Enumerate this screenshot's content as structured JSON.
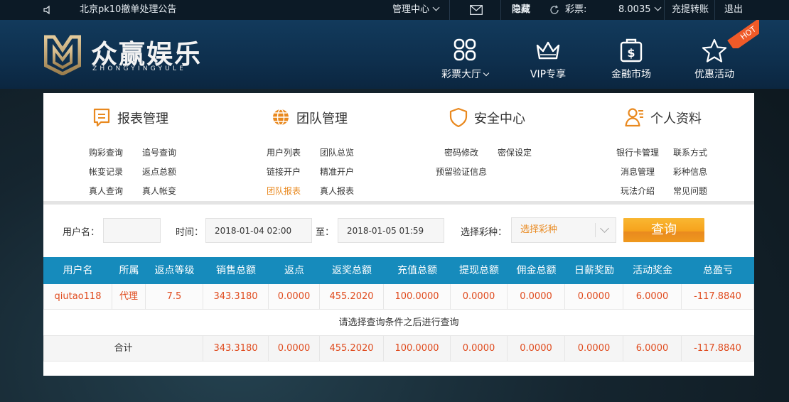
{
  "topbar": {
    "notice": "北京pk10撤单处理公告",
    "manage_center": "管理中心",
    "hide": "隐藏",
    "lottery_label": "彩票:",
    "balance": "8.0035",
    "deposit_withdraw": "充提转账",
    "logout": "退出"
  },
  "header": {
    "logo_cn": "众赢娱乐",
    "logo_en": "ZHONGYINGYULE",
    "nav": [
      {
        "label": "彩票大厅",
        "icon": "grid-icon"
      },
      {
        "label": "VIP专享",
        "icon": "crown-icon"
      },
      {
        "label": "金融市场",
        "icon": "money-bag-icon"
      },
      {
        "label": "优惠活动",
        "icon": "star-icon"
      }
    ],
    "hot_badge": "HOT"
  },
  "sections": [
    {
      "title": "报表管理",
      "icon": "report-icon",
      "links": [
        "购彩查询",
        "追号查询",
        "帐变记录",
        "返点总额",
        "真人查询",
        "真人帐变"
      ]
    },
    {
      "title": "团队管理",
      "icon": "globe-icon",
      "links": [
        "用户列表",
        "团队总览",
        "链接开户",
        "精准开户",
        "团队报表",
        "真人报表"
      ]
    },
    {
      "title": "安全中心",
      "icon": "shield-icon",
      "links": [
        "密码修改",
        "密保设定",
        "预留验证信息"
      ]
    },
    {
      "title": "个人资料",
      "icon": "user-icon",
      "links": [
        "银行卡管理",
        "联系方式",
        "消息管理",
        "彩种信息",
        "玩法介绍",
        "常见问题"
      ]
    }
  ],
  "filters": {
    "username_label": "用户名：",
    "username_value": "",
    "time_label": "时间：",
    "start_time": "2018-01-04 02:00",
    "to_label": "至：",
    "end_time": "2018-01-05 01:59",
    "lottery_type_label": "选择彩种：",
    "lottery_type_value": "选择彩种",
    "query_button": "查询"
  },
  "table": {
    "headers": [
      "用户名",
      "所属",
      "返点等级",
      "销售总额",
      "返点",
      "返奖总额",
      "充值总额",
      "提现总额",
      "佣金总额",
      "日薪奖励",
      "活动奖金",
      "总盈亏"
    ],
    "row": [
      "qiutao118",
      "代理",
      "7.5",
      "343.3180",
      "0.0000",
      "455.2020",
      "100.0000",
      "0.0000",
      "0.0000",
      "0.0000",
      "6.0000",
      "-117.8840"
    ],
    "hint": "请选择查询条件之后进行查询",
    "total_label": "合计",
    "totals": [
      "343.3180",
      "0.0000",
      "455.2020",
      "100.0000",
      "0.0000",
      "0.0000",
      "0.0000",
      "6.0000",
      "-117.8840"
    ]
  },
  "colors": {
    "accent_orange": "#e9891f",
    "table_header_blue": "#168bbc",
    "value_red": "#e04c1f",
    "hot_orange": "#ef5a28"
  }
}
